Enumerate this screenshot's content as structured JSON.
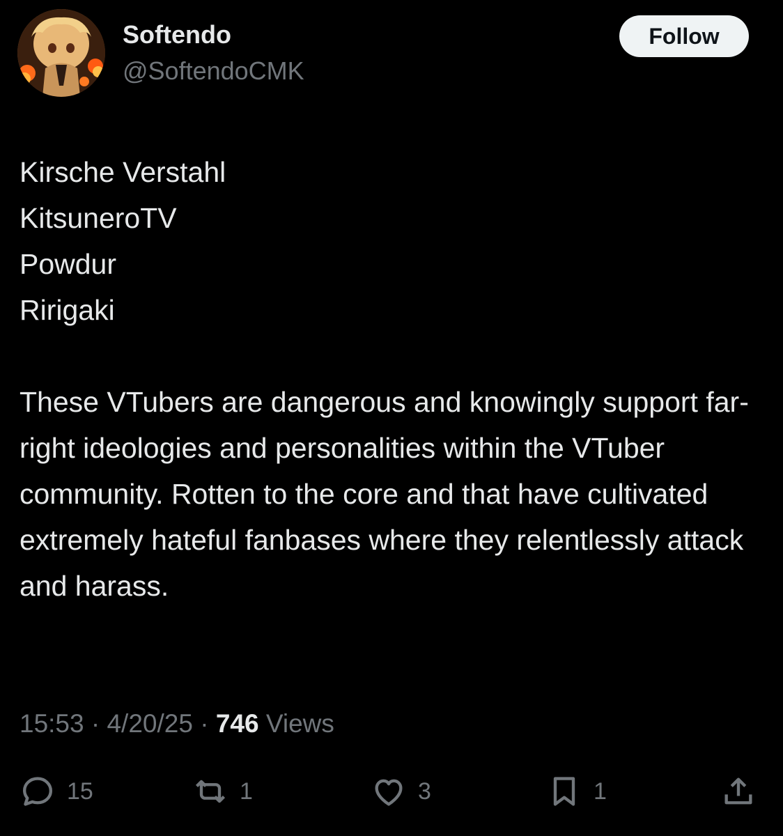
{
  "author": {
    "display_name": "Softendo",
    "handle": "@SoftendoCMK"
  },
  "follow_label": "Follow",
  "body": {
    "lines": [
      "Kirsche Verstahl",
      "KitsuneroTV",
      "Powdur",
      "Ririgaki"
    ],
    "paragraph": "These VTubers are dangerous and knowingly support far-right ideologies and personalities within the VTuber community. Rotten to the core and that have cultivated extremely hateful fanbases where they relentlessly attack and harass."
  },
  "meta": {
    "time": "15:53",
    "date": "4/20/25",
    "views_count": "746",
    "views_label": "Views",
    "separator": "·"
  },
  "actions": {
    "reply_count": "15",
    "repost_count": "1",
    "like_count": "3",
    "bookmark_count": "1",
    "icons": [
      "reply-icon",
      "repost-icon",
      "like-icon",
      "bookmark-icon",
      "share-icon"
    ]
  },
  "colors": {
    "background": "#000000",
    "primary_text": "#e7e9ea",
    "secondary_text": "#71767b",
    "follow_bg": "#eff3f4"
  }
}
